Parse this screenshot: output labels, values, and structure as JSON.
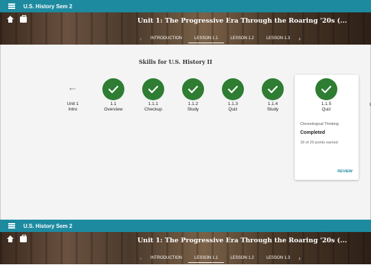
{
  "app": {
    "title": "U.S. History Sem 2"
  },
  "unit": {
    "title": "Unit 1: The Progressive Era Through the Roaring '20s (...",
    "tabs": [
      "INTRODUCTION",
      "LESSON 1.1",
      "LESSON 1.2",
      "LESSON 1.3"
    ],
    "active_tab": "LESSON 1.1"
  },
  "skills": {
    "title": "Skills for U.S. History II",
    "items": [
      {
        "num": "Unit 1",
        "name": "Intro"
      },
      {
        "num": "1.1",
        "name": "Overview"
      },
      {
        "num": "1.1.1",
        "name": "Checkup"
      },
      {
        "num": "1.1.2",
        "name": "Study"
      },
      {
        "num": "1.1.3",
        "name": "Quiz"
      },
      {
        "num": "1.1.4",
        "name": "Study"
      },
      {
        "num": "1.1.5",
        "name": "Quiz"
      }
    ],
    "edge_letter": "L"
  },
  "card": {
    "skill": "Chronological Thinking",
    "status": "Completed",
    "points": "18 of 20 points earned",
    "action": "REVIEW"
  },
  "colors": {
    "accent": "#1d8aa0",
    "check": "#2e7d32"
  }
}
